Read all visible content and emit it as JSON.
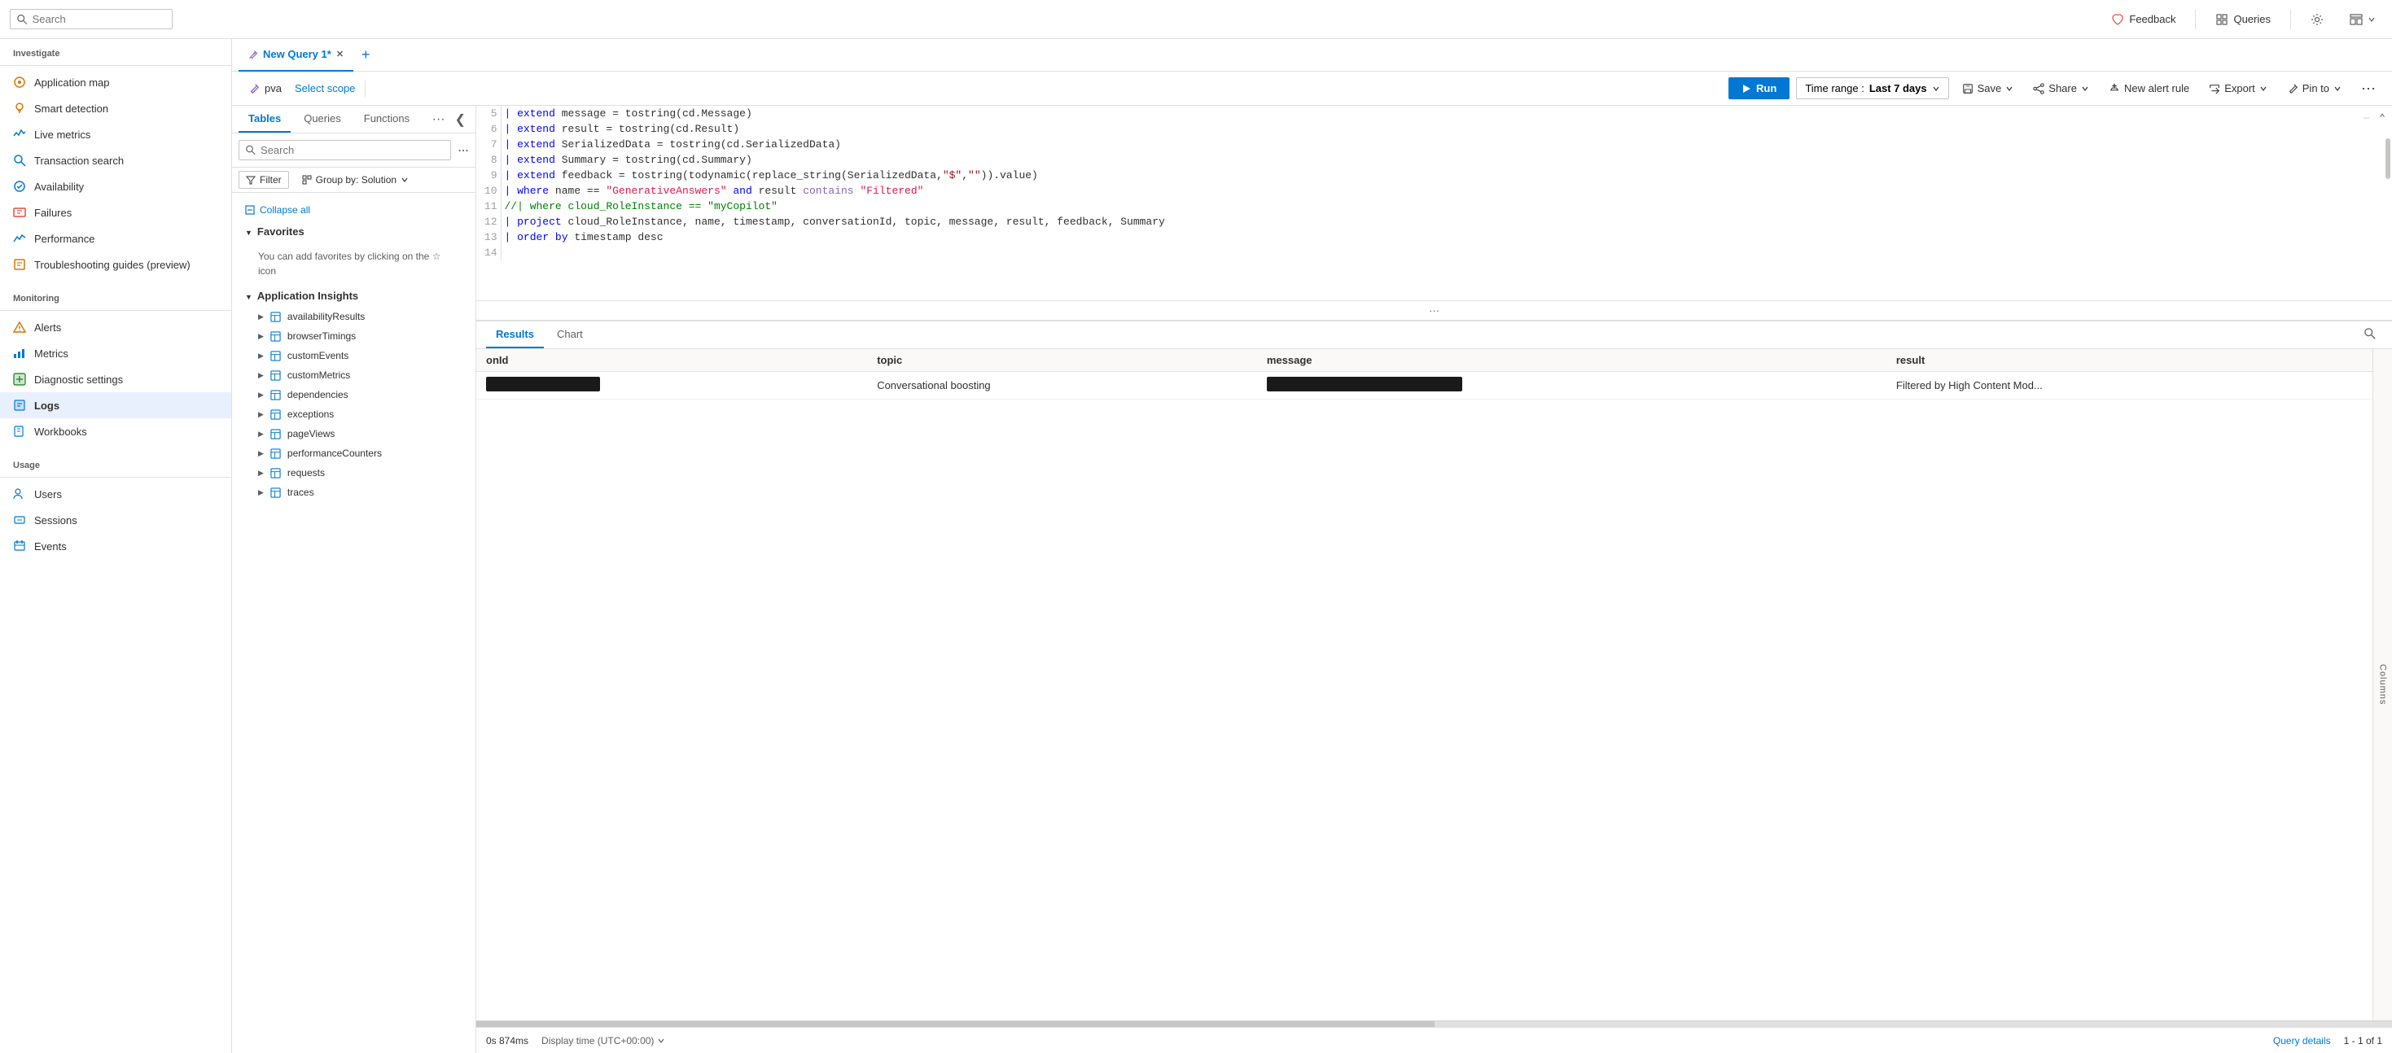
{
  "topbar": {
    "search_placeholder": "Search",
    "feedback_label": "Feedback",
    "queries_label": "Queries",
    "settings_icon": "gear-icon",
    "layout_icon": "layout-icon"
  },
  "tabs": [
    {
      "id": "query1",
      "label": "New Query 1*",
      "active": true
    },
    {
      "id": "add",
      "label": "+",
      "active": false
    }
  ],
  "toolbar": {
    "scope_icon": "pin-icon",
    "scope_name": "pva",
    "select_scope": "Select scope",
    "run_label": "Run",
    "time_range_prefix": "Time range :",
    "time_range_value": "Last 7 days",
    "save_label": "Save",
    "share_label": "Share",
    "new_alert_label": "New alert rule",
    "export_label": "Export",
    "pin_to_label": "Pin to",
    "more_icon": "more-icon"
  },
  "tables_panel": {
    "tabs": [
      "Tables",
      "Queries",
      "Functions"
    ],
    "active_tab": "Tables",
    "search_placeholder": "Search",
    "filter_label": "Filter",
    "group_by_label": "Group by: Solution",
    "collapse_all": "Collapse all",
    "sections": {
      "favorites": {
        "label": "Favorites",
        "empty_text": "You can add favorites by clicking on the ☆ icon"
      },
      "app_insights": {
        "label": "Application Insights",
        "tables": [
          "availabilityResults",
          "browserTimings",
          "customEvents",
          "customMetrics",
          "dependencies",
          "exceptions",
          "pageViews",
          "performanceCounters",
          "requests",
          "traces"
        ]
      }
    }
  },
  "editor": {
    "lines": [
      {
        "num": 5,
        "code": "| extend message = tostring(cd.Message)"
      },
      {
        "num": 6,
        "code": "| extend result = tostring(cd.Result)"
      },
      {
        "num": 7,
        "code": "| extend SerializedData = tostring(cd.SerializedData)"
      },
      {
        "num": 8,
        "code": "| extend Summary = tostring(cd.Summary)"
      },
      {
        "num": 9,
        "code": "| extend feedback = tostring(todynamic(replace_string(SerializedData,\"$\",\"\")).value)"
      },
      {
        "num": 10,
        "code": "| where name == \"GenerativeAnswers\" and result contains \"Filtered\""
      },
      {
        "num": 11,
        "code": "//| where cloud_RoleInstance == \"myCopilot\""
      },
      {
        "num": 12,
        "code": "| project cloud_RoleInstance, name, timestamp, conversationId, topic, message, result, feedback, Summary"
      },
      {
        "num": 13,
        "code": "| order by timestamp desc"
      },
      {
        "num": 14,
        "code": ""
      }
    ]
  },
  "results": {
    "tabs": [
      "Results",
      "Chart"
    ],
    "active_tab": "Results",
    "columns": [
      "onId",
      "topic",
      "message",
      "result"
    ],
    "rows": [
      {
        "onId": "[REDACTED]",
        "topic": "Conversational boosting",
        "message": "[REDACTED_WIDE]",
        "result": "Filtered by High Content Mod..."
      }
    ],
    "columns_btn": "Columns"
  },
  "statusbar": {
    "time": "0s 874ms",
    "display_label": "Display time (UTC+00:00)",
    "query_details": "Query details",
    "results_count": "1 - 1 of 1"
  },
  "sidebar": {
    "items_top": [
      {
        "id": "investigate",
        "label": "Investigate",
        "is_section": true
      },
      {
        "id": "application-map",
        "label": "Application map",
        "icon": "map-icon",
        "color": "orange"
      },
      {
        "id": "smart-detection",
        "label": "Smart detection",
        "icon": "bulb-icon",
        "color": "orange"
      },
      {
        "id": "live-metrics",
        "label": "Live metrics",
        "icon": "live-icon",
        "color": "blue"
      },
      {
        "id": "transaction-search",
        "label": "Transaction search",
        "icon": "search-icon",
        "color": "blue"
      },
      {
        "id": "availability",
        "label": "Availability",
        "icon": "check-icon",
        "color": "blue"
      },
      {
        "id": "failures",
        "label": "Failures",
        "icon": "fail-icon",
        "color": "red"
      },
      {
        "id": "performance",
        "label": "Performance",
        "icon": "perf-icon",
        "color": "blue"
      },
      {
        "id": "troubleshooting",
        "label": "Troubleshooting guides (preview)",
        "icon": "guide-icon",
        "color": "orange"
      }
    ],
    "monitoring_section": "Monitoring",
    "items_monitoring": [
      {
        "id": "alerts",
        "label": "Alerts",
        "icon": "alert-icon",
        "color": "orange"
      },
      {
        "id": "metrics",
        "label": "Metrics",
        "icon": "metrics-icon",
        "color": "blue"
      },
      {
        "id": "diagnostic-settings",
        "label": "Diagnostic settings",
        "icon": "diag-icon",
        "color": "green"
      },
      {
        "id": "logs",
        "label": "Logs",
        "icon": "logs-icon",
        "color": "blue",
        "active": true
      },
      {
        "id": "workbooks",
        "label": "Workbooks",
        "icon": "book-icon",
        "color": "blue"
      }
    ],
    "usage_section": "Usage",
    "items_usage": [
      {
        "id": "users",
        "label": "Users",
        "icon": "users-icon",
        "color": "blue"
      },
      {
        "id": "sessions",
        "label": "Sessions",
        "icon": "sessions-icon",
        "color": "blue"
      },
      {
        "id": "events",
        "label": "Events",
        "icon": "events-icon",
        "color": "blue"
      }
    ]
  }
}
